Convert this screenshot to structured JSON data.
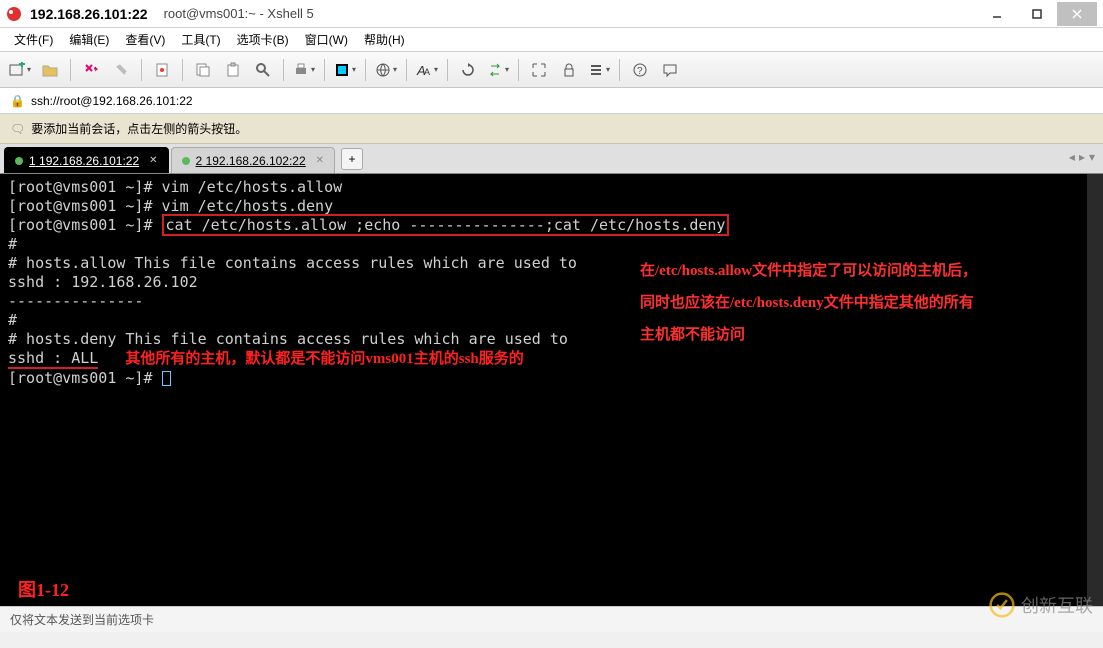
{
  "window": {
    "title_main": "192.168.26.101:22",
    "title_sub": "root@vms001:~ - Xshell 5"
  },
  "menubar": {
    "file": "文件(F)",
    "edit": "编辑(E)",
    "view": "查看(V)",
    "tools": "工具(T)",
    "tabs": "选项卡(B)",
    "window": "窗口(W)",
    "help": "帮助(H)"
  },
  "addressbar": {
    "url": "ssh://root@192.168.26.101:22"
  },
  "hintbar": {
    "text": "要添加当前会话，点击左侧的箭头按钮。"
  },
  "tabs": {
    "items": [
      {
        "index": "1",
        "label": "192.168.26.101:22",
        "active": true
      },
      {
        "index": "2",
        "label": "192.168.26.102:22",
        "active": false
      }
    ],
    "add": "+"
  },
  "terminal": {
    "line1_prompt": "[root@vms001 ~]#",
    "line1_cmd": " vim /etc/hosts.allow",
    "line2_prompt": "[root@vms001 ~]#",
    "line2_cmd": " vim /etc/hosts.deny",
    "line3_prompt": "[root@vms001 ~]#",
    "line3_cmd": "cat /etc/hosts.allow ;echo ---------------;cat /etc/hosts.deny",
    "line4": "#",
    "line5": "# hosts.allow   This file contains access rules which are used to",
    "line6": "",
    "line7": "sshd : 192.168.26.102",
    "line8": "---------------",
    "line9": "#",
    "line10": "# hosts.deny    This file contains access rules which are used to",
    "line11": "",
    "line12": "sshd : ALL",
    "line13_prompt": "[root@vms001 ~]#",
    "annotation_right_1": "在/etc/hosts.allow文件中指定了可以访问的主机后，",
    "annotation_right_2": "同时也应该在/etc/hosts.deny文件中指定其他的所有",
    "annotation_right_3": "主机都不能访问",
    "annotation_inline": "其他所有的主机，默认都是不能访问vms001主机的ssh服务的",
    "fig_label": "图1-12"
  },
  "statusbar": {
    "text": "仅将文本发送到当前选项卡"
  },
  "watermark": {
    "text": "创新互联"
  },
  "icon_names": {
    "app": "xshell-icon",
    "minimize": "minimize-icon",
    "maximize": "maximize-icon",
    "close": "close-icon",
    "lock": "lock-icon",
    "speaker": "speaker-icon"
  }
}
